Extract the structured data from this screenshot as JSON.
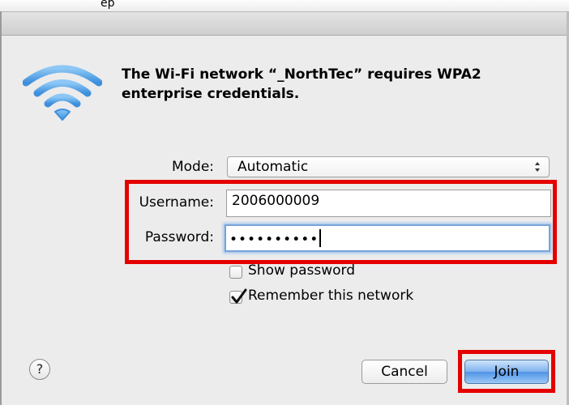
{
  "menubar": {
    "text": "ep"
  },
  "dialog": {
    "message": "The Wi-Fi network “_NorthTec” requires WPA2 enterprise credentials.",
    "mode": {
      "label": "Mode:",
      "value": "Automatic"
    },
    "username": {
      "label": "Username:",
      "value": "2006000009"
    },
    "password": {
      "label": "Password:",
      "masked_value": "••••••••••"
    },
    "show_password": {
      "label": "Show password",
      "checked": false
    },
    "remember_network": {
      "label": "Remember this network",
      "checked": true
    },
    "help_button": {
      "label": "?"
    },
    "cancel_button": {
      "label": "Cancel"
    },
    "join_button": {
      "label": "Join"
    }
  },
  "colors": {
    "highlight": "#e50000",
    "wifi_icon": "#5aa9ea",
    "focus_ring": "#77a4d8",
    "default_button": "#4f94e6"
  },
  "icons": [
    "wifi-icon",
    "popup-arrows-icon",
    "checkmark-icon",
    "help-icon"
  ]
}
